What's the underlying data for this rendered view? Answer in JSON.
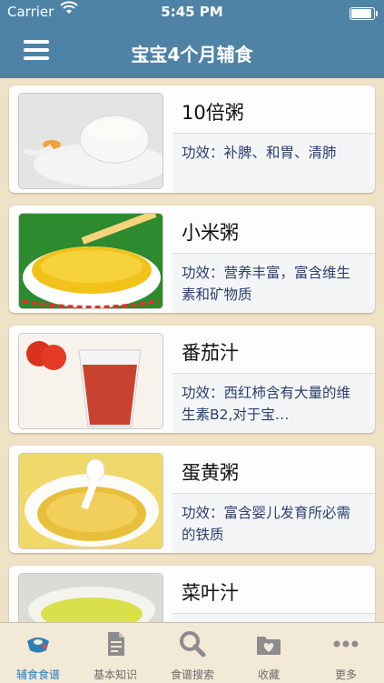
{
  "status_bar": {
    "carrier": "Carrier",
    "time": "5:45 PM"
  },
  "nav": {
    "title": "宝宝4个月辅食",
    "menu_icon": "hamburger-menu-icon"
  },
  "recipes": [
    {
      "title": "10倍粥",
      "desc": "功效：补脾、和胃、清肺"
    },
    {
      "title": "小米粥",
      "desc": "功效：营养丰富，富含维生素和矿物质"
    },
    {
      "title": "番茄汁",
      "desc": "功效：西红柿含有大量的维生素B2,对于宝…"
    },
    {
      "title": "蛋黄粥",
      "desc": "功效：富含婴儿发育所必需的铁质"
    },
    {
      "title": "菜叶汁",
      "desc": ""
    }
  ],
  "tabs": [
    {
      "label": "辅食食谱",
      "icon": "bib-icon",
      "active": true
    },
    {
      "label": "基本知识",
      "icon": "document-icon",
      "active": false
    },
    {
      "label": "食谱搜索",
      "icon": "search-icon",
      "active": false
    },
    {
      "label": "收藏",
      "icon": "heart-folder-icon",
      "active": false
    },
    {
      "label": "更多",
      "icon": "more-dots-icon",
      "active": false
    }
  ],
  "colors": {
    "nav_bar": "#4f83a6",
    "page_bg": "#efe2c6",
    "desc_text": "#2b3f6e",
    "tab_active": "#2e7db8"
  }
}
